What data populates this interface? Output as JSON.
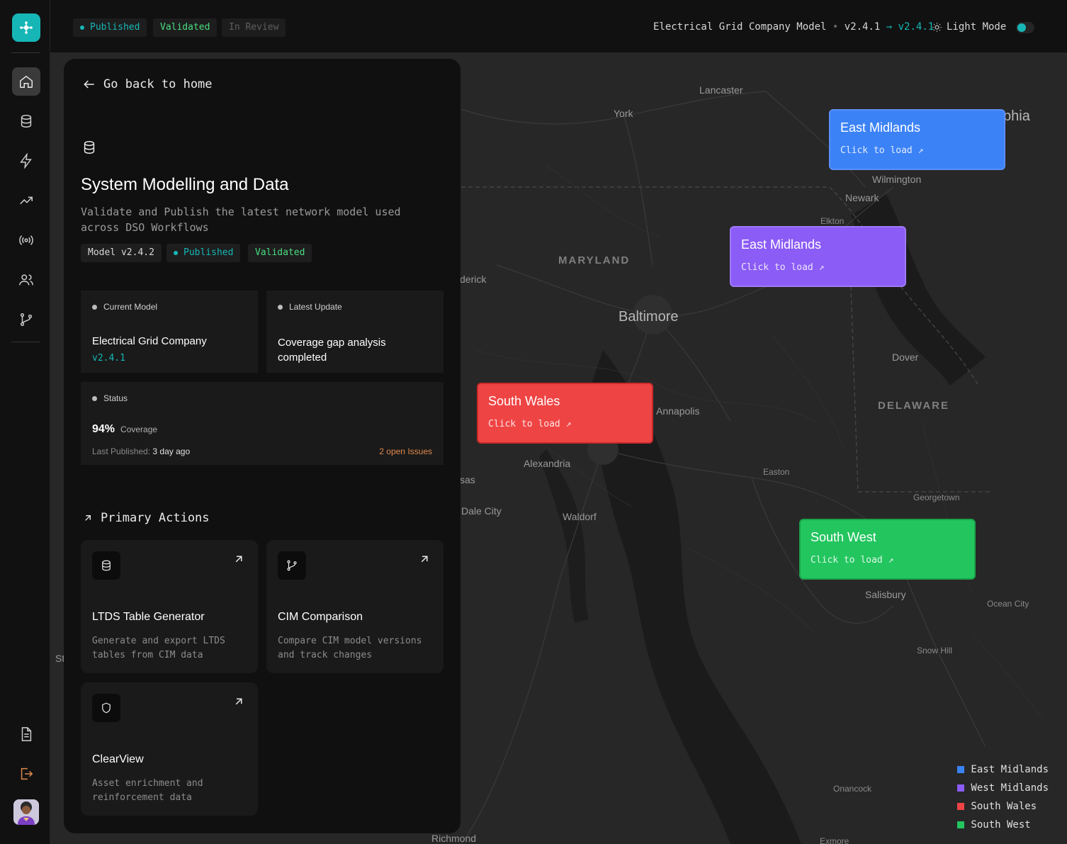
{
  "topbar": {
    "status_published": "Published",
    "status_validated": "Validated",
    "status_in_review": "In Review",
    "model_name": "Electrical Grid Company Model",
    "version_from": "v2.4.1",
    "version_to": "v2.4.1",
    "light_mode_label": "Light Mode"
  },
  "sidebar": {
    "items": [
      {
        "name": "home-icon",
        "active": true
      },
      {
        "name": "database-icon",
        "active": false
      },
      {
        "name": "lightning-icon",
        "active": false
      },
      {
        "name": "trending-up-icon",
        "active": false
      },
      {
        "name": "broadcast-icon",
        "active": false
      },
      {
        "name": "users-icon",
        "active": false
      },
      {
        "name": "git-branch-icon",
        "active": false
      }
    ],
    "bottom": [
      "document-icon",
      "logout-icon",
      "avatar"
    ]
  },
  "panel": {
    "back_label": "Go back to home",
    "title": "System Modelling and Data",
    "description": "Validate and Publish the latest network model used across DSO Workflows",
    "chips": {
      "model": "Model v2.4.2",
      "published": "Published",
      "validated": "Validated"
    },
    "current_model": {
      "label": "Current Model",
      "name": "Electrical Grid Company",
      "version": "v2.4.1"
    },
    "latest_update": {
      "label": "Latest Update",
      "text": "Coverage gap analysis completed"
    },
    "status": {
      "label": "Status",
      "coverage_value": "94%",
      "coverage_label": "Coverage",
      "last_published_label": "Last Published:",
      "last_published_value": "3 day ago",
      "issues": "2 open Issues"
    },
    "primary_actions_label": "Primary Actions",
    "actions": [
      {
        "icon": "database-icon",
        "title": "LTDS Table Generator",
        "desc": "Generate and export LTDS tables from CIM data"
      },
      {
        "icon": "git-branch-icon",
        "title": "CIM Comparison",
        "desc": "Compare CIM model versions and track changes"
      },
      {
        "icon": "shield-icon",
        "title": "ClearView",
        "desc": "Asset enrichment and reinforcement data"
      }
    ]
  },
  "map": {
    "places": {
      "lancaster": "Lancaster",
      "york": "York",
      "phia": "phia",
      "wilmington": "Wilmington",
      "newark": "Newark",
      "elkton": "Elkton",
      "maryland": "MARYLAND",
      "frederick": "derick",
      "baltimore": "Baltimore",
      "dover": "Dover",
      "delaware": "DELAWARE",
      "annapolis": "Annapolis",
      "alexandria": "Alexandria",
      "manassas": "sas",
      "easton": "Easton",
      "georgetown": "Georgetown",
      "dalecity": "Dale City",
      "waldorf": "Waldorf",
      "salisbury": "Salisbury",
      "oceancity": "Ocean City",
      "snowhill": "Snow Hill",
      "st": "St",
      "onancock": "Onancock",
      "richmond": "Richmond",
      "exmore": "Exmore"
    },
    "cards": [
      {
        "title": "East Midlands",
        "sub": "Click to load",
        "color": "#3b82f6",
        "border": "#5b8ff9"
      },
      {
        "title": "East Midlands",
        "sub": "Click to load",
        "color": "#8b5cf6",
        "border": "#a07af7"
      },
      {
        "title": "South Wales",
        "sub": "Click to load",
        "color": "#ef4444",
        "border": "#c92a2a"
      },
      {
        "title": "South West",
        "sub": "Click to load",
        "color": "#22c55e",
        "border": "#1aa34a"
      }
    ],
    "legend": [
      {
        "label": "East Midlands",
        "color": "#3b82f6"
      },
      {
        "label": "West Midlands",
        "color": "#8b5cf6"
      },
      {
        "label": "South Wales",
        "color": "#ef4444"
      },
      {
        "label": "South West",
        "color": "#22c55e"
      }
    ]
  },
  "colors": {
    "accent": "#17b6b6",
    "validated": "#4ade80",
    "published": "#17b6b6",
    "issues": "#e08a4a"
  }
}
